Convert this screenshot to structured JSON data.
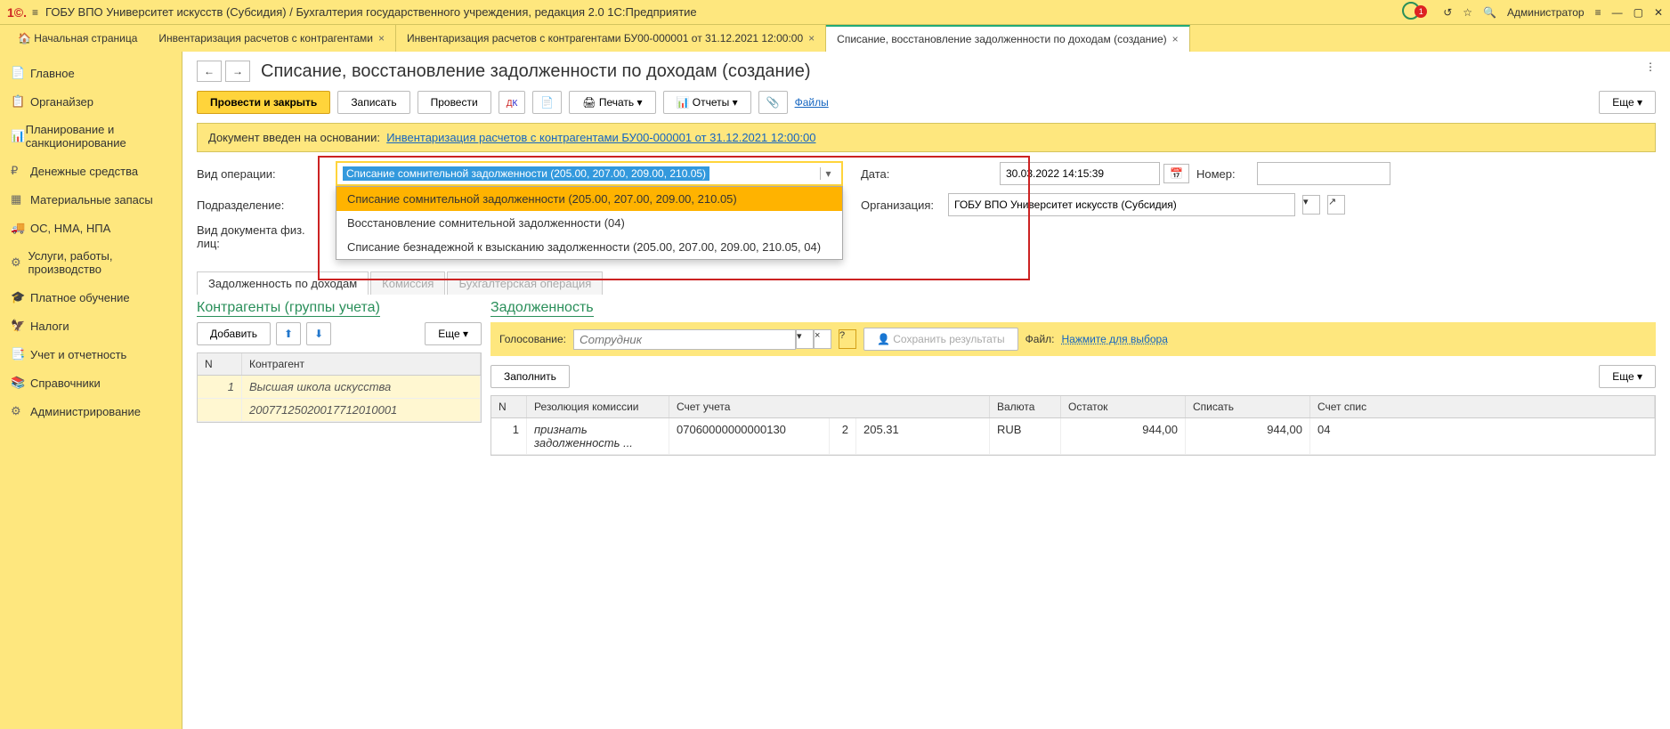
{
  "topbar": {
    "title": "ГОБУ ВПО Университет искусств (Субсидия) / Бухгалтерия государственного учреждения, редакция 2.0 1С:Предприятие",
    "user": "Администратор",
    "notif_count": "1"
  },
  "home_tab": "Начальная страница",
  "tabs": [
    {
      "label": "Инвентаризация расчетов с контрагентами",
      "active": false
    },
    {
      "label": "Инвентаризация расчетов с контрагентами БУ00-000001 от 31.12.2021 12:00:00",
      "active": false
    },
    {
      "label": "Списание, восстановление задолженности по доходам (создание)",
      "active": true
    }
  ],
  "sidebar": [
    "Главное",
    "Органайзер",
    "Планирование и санкционирование",
    "Денежные средства",
    "Материальные запасы",
    "ОС, НМА, НПА",
    "Услуги, работы, производство",
    "Платное обучение",
    "Налоги",
    "Учет и отчетность",
    "Справочники",
    "Администрирование"
  ],
  "page_title": "Списание, восстановление задолженности по доходам (создание)",
  "toolbar": {
    "save_close": "Провести и закрыть",
    "write": "Записать",
    "post": "Провести",
    "print": "Печать",
    "reports": "Отчеты",
    "files": "Файлы",
    "more": "Еще"
  },
  "info": {
    "prefix": "Документ введен на основании:",
    "link": "Инвентаризация расчетов с контрагентами БУ00-000001 от 31.12.2021 12:00:00"
  },
  "form": {
    "op_label": "Вид операции:",
    "op_value": "Списание сомнительной задолженности (205.00, 207.00, 209.00, 210.05)",
    "op_options": [
      "Списание сомнительной задолженности (205.00, 207.00, 209.00, 210.05)",
      "Восстановление сомнительной задолженности (04)",
      "Списание безнадежной к взысканию задолженности (205.00, 207.00, 209.00, 210.05, 04)"
    ],
    "dept_label": "Подразделение:",
    "doc_type_label": "Вид документа физ. лиц:",
    "date_label": "Дата:",
    "date_value": "30.03.2022 14:15:39",
    "num_label": "Номер:",
    "org_label": "Организация:",
    "org_value": "ГОБУ ВПО Университет искусств (Субсидия)"
  },
  "doc_tabs": [
    "Задолженность по доходам",
    "Комиссия",
    "Бухгалтерская операция"
  ],
  "left": {
    "title": "Контрагенты (группы учета)",
    "add": "Добавить",
    "more": "Еще",
    "cols": {
      "n": "N",
      "agent": "Контрагент"
    },
    "row": {
      "n": "1",
      "agent": "Высшая школа искусства",
      "code": "20077125020017712010001"
    }
  },
  "right": {
    "title": "Задолженность",
    "vote_label": "Голосование:",
    "vote_placeholder": "Сотрудник",
    "save_results": "Сохранить результаты",
    "file_label": "Файл:",
    "file_link": "Нажмите для выбора",
    "fill": "Заполнить",
    "more": "Еще",
    "cols": {
      "n": "N",
      "res": "Резолюция комиссии",
      "acc": "Счет учета",
      "cur": "Валюта",
      "rem": "Остаток",
      "wo": "Списать",
      "woacc": "Счет спис"
    },
    "row": {
      "n": "1",
      "res": "признать задолженность ...",
      "acc1": "07060000000000130",
      "acc1n": "2",
      "acc2": "205.31",
      "cur": "RUB",
      "rem": "944,00",
      "wo": "944,00",
      "woacc": "04"
    }
  }
}
